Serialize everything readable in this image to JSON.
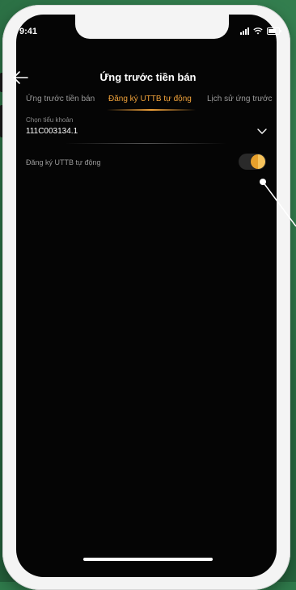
{
  "status_bar": {
    "time": "9:41"
  },
  "header": {
    "title": "Ứng trước tiền bán"
  },
  "tabs": [
    {
      "label": "Ứng trước tiền bán"
    },
    {
      "label": "Đăng ký UTTB tự động"
    },
    {
      "label": "Lịch sử ứng trước"
    }
  ],
  "account": {
    "label": "Chọn tiểu khoản",
    "value": "111C003134.1"
  },
  "auto_register": {
    "label": "Đăng ký UTTB tự động",
    "enabled": true
  },
  "colors": {
    "accent": "#f0a23a",
    "background": "#050505",
    "outer": "#2f7a4b"
  },
  "icons": {
    "back": "back-arrow-icon",
    "dropdown": "chevron-down-icon"
  }
}
